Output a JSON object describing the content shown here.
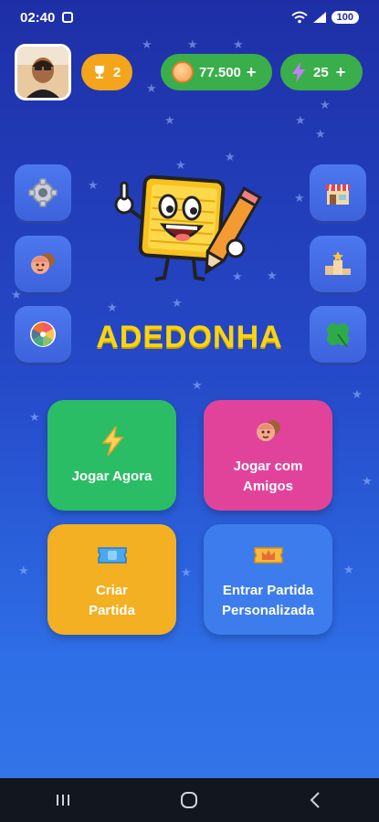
{
  "status_bar": {
    "time": "02:40",
    "battery": "100"
  },
  "top_bar": {
    "trophies": "2",
    "coins": "77.500",
    "coins_plus": "+",
    "energy": "25",
    "energy_plus": "+"
  },
  "side_menu": {
    "left": [
      "gear-icon",
      "friends-icon",
      "wheel-icon"
    ],
    "right": [
      "shop-icon",
      "podium-icon",
      "clover-icon"
    ]
  },
  "title": "ADEDONHA",
  "cards": {
    "play_now": "Jogar Agora",
    "play_friends": "Jogar com\nAmigos",
    "create_match": "Criar\nPartida",
    "join_custom": "Entrar Partida\nPersonalizada"
  },
  "colors": {
    "bg_top": "#1e2fa6",
    "bg_bottom": "#3576ea",
    "title": "#f7d414",
    "green": "#2bbd66",
    "pink": "#e1439b",
    "yellow": "#f2b022",
    "blue": "#3d7cec",
    "orange": "#f4a51c"
  }
}
